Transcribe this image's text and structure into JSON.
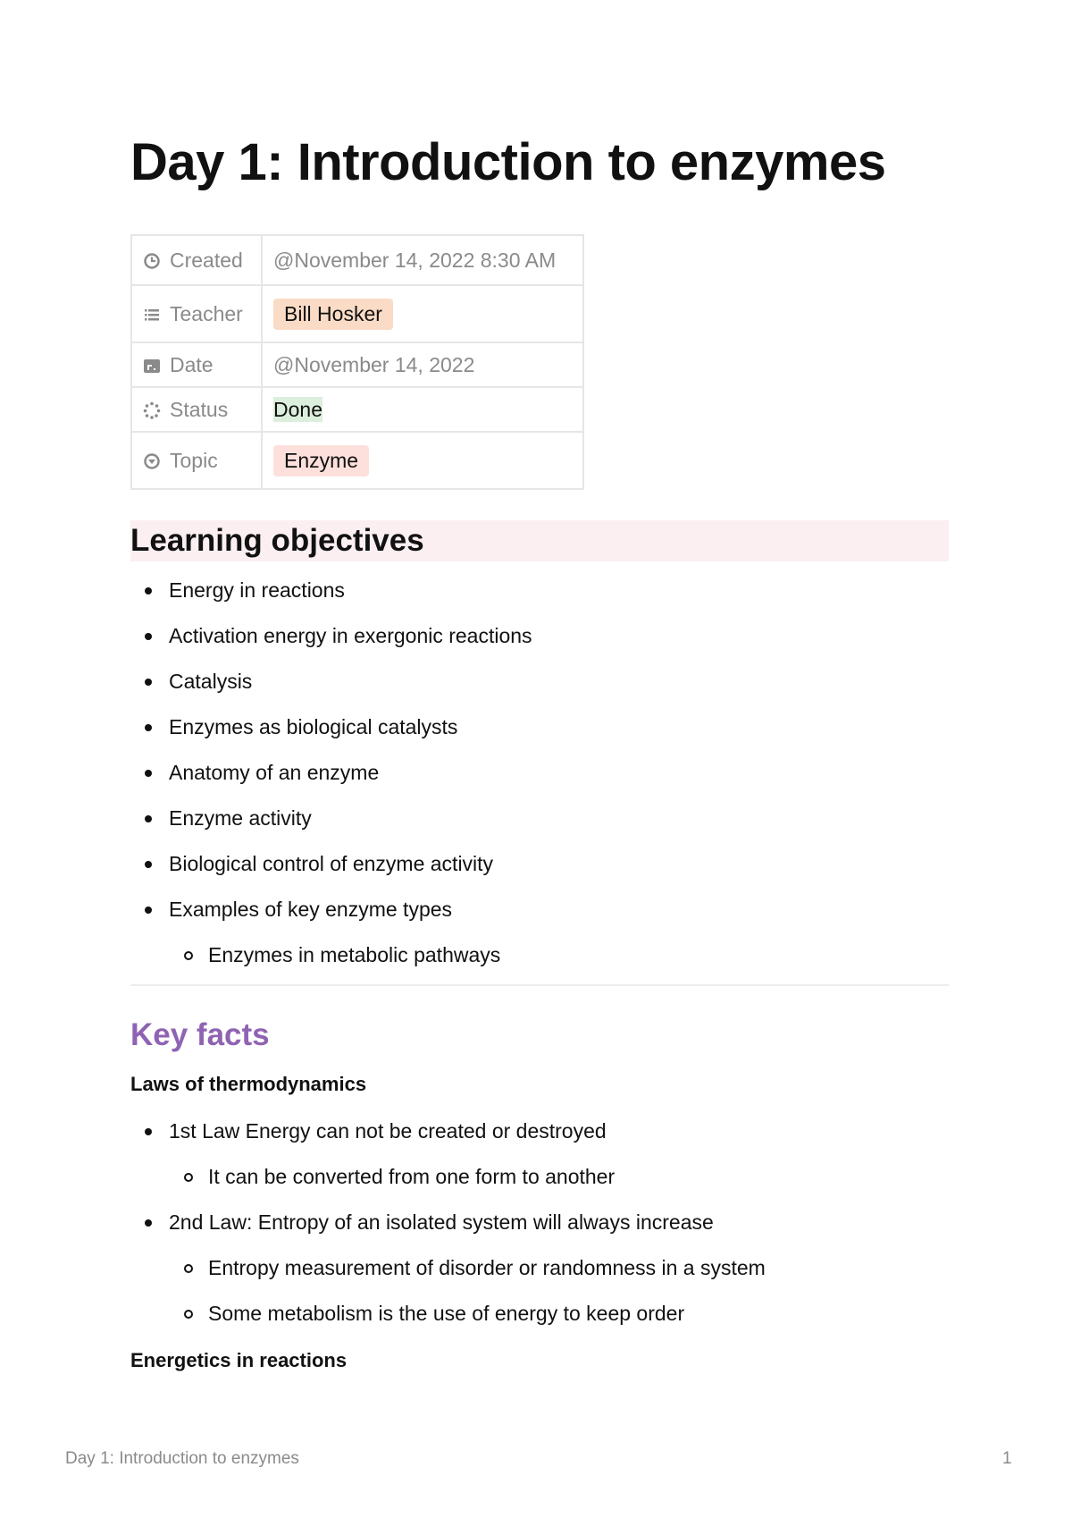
{
  "document": {
    "title": "Day 1: Introduction to enzymes"
  },
  "properties": [
    {
      "key": "Created",
      "icon": "clock-icon",
      "value": "@November 14, 2022 8:30 AM",
      "type": "text"
    },
    {
      "key": "Teacher",
      "icon": "list-icon",
      "value": "Bill Hosker",
      "type": "tag",
      "color": "#fadbc6"
    },
    {
      "key": "Date",
      "icon": "calendar-icon",
      "value": "@November 14, 2022",
      "type": "text"
    },
    {
      "key": "Status",
      "icon": "status-icon",
      "value": "Done",
      "type": "status",
      "color": "#dcefdc"
    },
    {
      "key": "Topic",
      "icon": "select-icon",
      "value": "Enzyme",
      "type": "tag",
      "color": "#fde0dc"
    }
  ],
  "learning_objectives": {
    "heading": "Learning objectives",
    "items": [
      {
        "text": "Energy in reactions",
        "level": 1
      },
      {
        "text": "Activation energy in exergonic reactions",
        "level": 1
      },
      {
        "text": "Catalysis",
        "level": 1
      },
      {
        "text": "Enzymes as biological catalysts",
        "level": 1
      },
      {
        "text": "Anatomy of an enzyme",
        "level": 1
      },
      {
        "text": "Enzyme activity",
        "level": 1
      },
      {
        "text": "Biological control of enzyme activity",
        "level": 1
      },
      {
        "text": "Examples of key enzyme types",
        "level": 1
      },
      {
        "text": "Enzymes in metabolic pathways",
        "level": 2
      }
    ]
  },
  "key_facts": {
    "heading": "Key facts",
    "heading_color": "#8f63b3",
    "subheading_1": "Laws of thermodynamics",
    "items": [
      {
        "text": "1st Law Energy can not be created or destroyed",
        "level": 1
      },
      {
        "text": "It can be converted from one form to another",
        "level": 2
      },
      {
        "text": "2nd Law: Entropy of an isolated system will always increase",
        "level": 1
      },
      {
        "text": "Entropy measurement of disorder or randomness in a system",
        "level": 2
      },
      {
        "text": "Some metabolism is the use of energy to keep order",
        "level": 2
      }
    ],
    "subheading_2": "Energetics in reactions"
  },
  "footer": {
    "title": "Day 1: Introduction to enzymes",
    "page_number": "1"
  }
}
